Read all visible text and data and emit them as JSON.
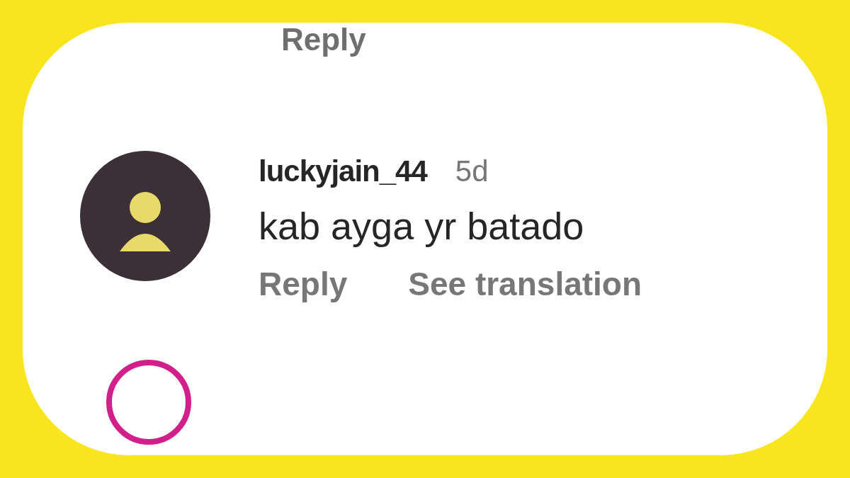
{
  "previous_comment": {
    "reply_label": "Reply"
  },
  "comment": {
    "username": "luckyjain_44",
    "time": "5d",
    "text": "kab ayga yr batado",
    "actions": [
      "Reply",
      "See translation"
    ]
  },
  "next_comment": {
    "story_ring": true
  }
}
